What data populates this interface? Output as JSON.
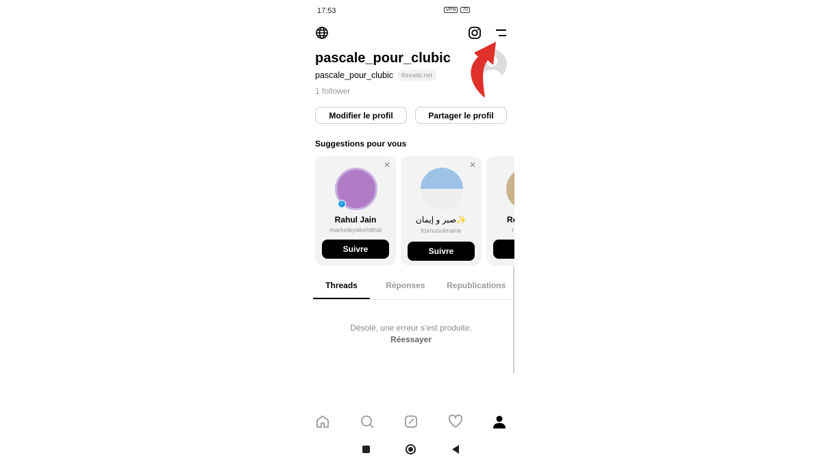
{
  "status_bar": {
    "time": "17:53",
    "vpn": "VPN",
    "battery": "70"
  },
  "profile": {
    "display_name": "pascale_pour_clubic",
    "username": "pascale_pour_clubic",
    "domain": "threads.net",
    "followers": "1 follower",
    "edit_label": "Modifier le profil",
    "share_label": "Partager le profil"
  },
  "suggestions": {
    "title": "Suggestions pour vous",
    "items": [
      {
        "name": "Rahul Jain",
        "username": "marketkyakehtihai",
        "button": "Suivre",
        "verified": true
      },
      {
        "name": "✨صبر و إيمان",
        "username": "foimusulmane",
        "button": "Suivre"
      },
      {
        "name": "Re",
        "username": "r",
        "button": "Suivre"
      }
    ]
  },
  "tabs": [
    "Threads",
    "Réponses",
    "Republications"
  ],
  "error": {
    "message": "Désolé, une erreur s’est produite.",
    "retry": "Réessayer"
  },
  "colors": {
    "arrow": "#e0302a",
    "verified": "#1d9bf0"
  }
}
